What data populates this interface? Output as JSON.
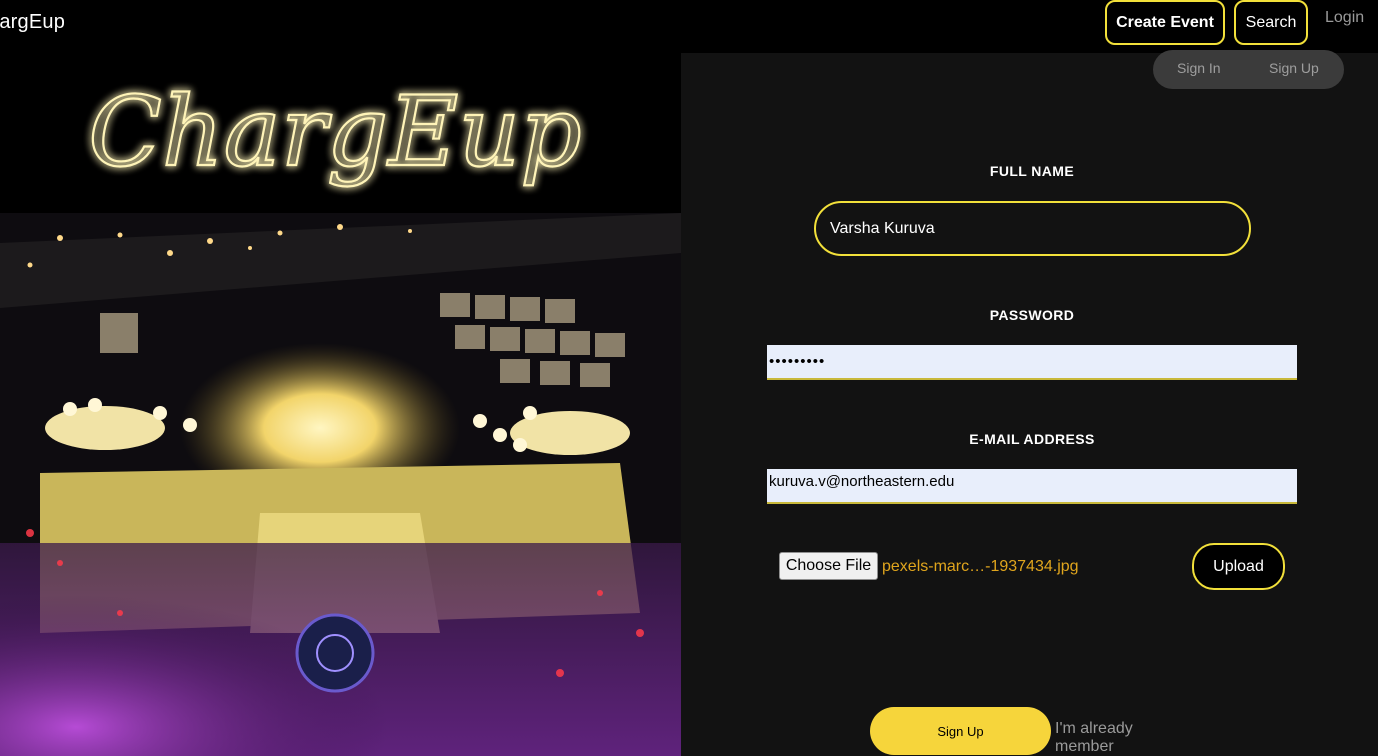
{
  "navbar": {
    "brand": "hargEup",
    "create_event_label": "Create Event",
    "search_label": "Search",
    "login_label": "Login"
  },
  "hero": {
    "logo_text": "ChargEup",
    "photo_description_icon": "festival-aerial-photo"
  },
  "auth_toggle": {
    "sign_in_label": "Sign In",
    "sign_up_label": "Sign Up"
  },
  "form": {
    "full_name": {
      "label": "FULL NAME",
      "value": "Varsha Kuruva"
    },
    "password": {
      "label": "PASSWORD",
      "value": "•••••••••"
    },
    "email": {
      "label": "E-MAIL ADDRESS",
      "value": "kuruva.v@northeastern.edu"
    },
    "file": {
      "choose_label": "Choose File",
      "file_name": "pexels-marc…-1937434.jpg",
      "upload_label": "Upload"
    },
    "sign_up_label": "Sign Up",
    "already_member_label": "I'm already member"
  },
  "colors": {
    "accent_yellow": "#f2e03a",
    "signup_yellow": "#f6d53b",
    "file_name_orange": "#e0a51d",
    "panel_bg": "#121212",
    "input_bg": "#e8eefb"
  }
}
